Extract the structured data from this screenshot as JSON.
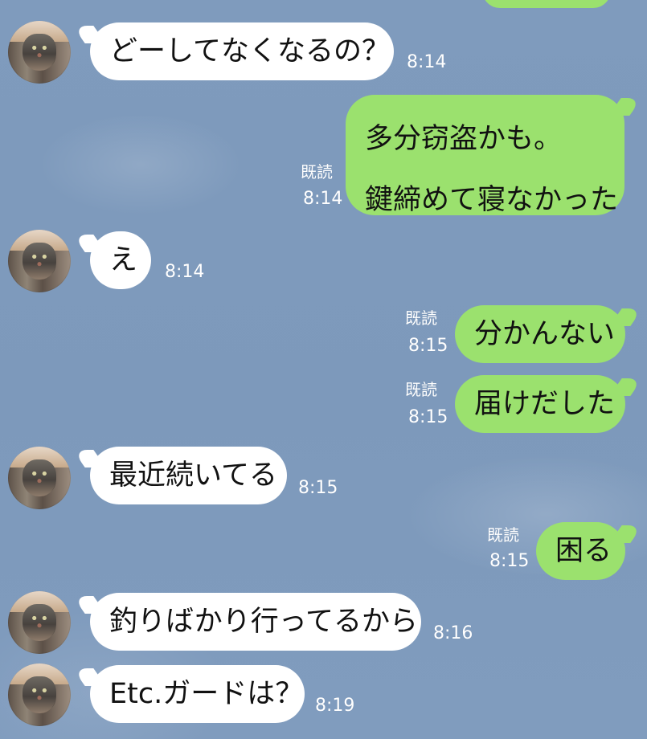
{
  "messages": [
    {
      "text": "どーしてなくなるの？",
      "time": "8:14"
    },
    {
      "line1": "多分窃盗かも。",
      "line2": "鍵締めて寝なかった",
      "read": "既読",
      "time": "8:14"
    },
    {
      "text": "え",
      "time": "8:14"
    },
    {
      "text": "分かんない",
      "read": "既読",
      "time": "8:15"
    },
    {
      "text": "届けだした",
      "read": "既読",
      "time": "8:15"
    },
    {
      "text": "最近続いてる",
      "time": "8:15"
    },
    {
      "text": "困る",
      "read": "既読",
      "time": "8:15"
    },
    {
      "text": "釣りばかり行ってるから",
      "time": "8:16"
    },
    {
      "text": "Etc.ガードは？",
      "time": "8:19"
    }
  ]
}
